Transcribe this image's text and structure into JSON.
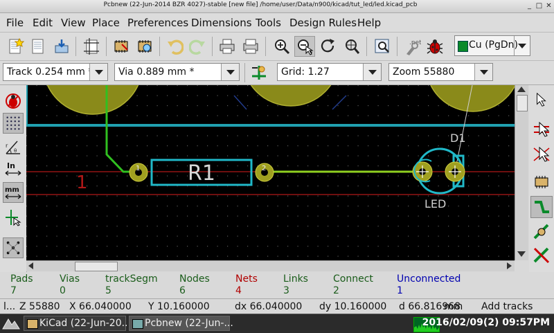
{
  "window": {
    "title": "Pcbnew (22-Jun-2014 BZR 4027)-stable  [new file] /home/user/Data/n900/kicad/tut_led/led.kicad_pcb",
    "min": "_",
    "max": "□",
    "close": "✕"
  },
  "menu": [
    "File",
    "Edit",
    "View",
    "Place",
    "Preferences",
    "Dimensions",
    "Tools",
    "Design Rules",
    "Help"
  ],
  "toolbar": {
    "layer_label": "Cu (PgDn)",
    "icons": [
      "new-board-icon",
      "open-board-icon",
      "save-icon",
      "page-settings-icon",
      "module-editor-icon",
      "module-viewer-icon",
      "undo-icon",
      "redo-icon",
      "print-icon",
      "plot-icon",
      "zoom-in-icon",
      "zoom-out-icon",
      "redraw-icon",
      "zoom-fit-icon",
      "find-icon",
      "netlist-icon",
      "drc-icon"
    ]
  },
  "aux_toolbar": {
    "track": "Track 0.254 mm *",
    "via": "Via 0.889 mm *",
    "grid": "Grid: 1.27",
    "zoom": "Zoom 55880"
  },
  "canvas": {
    "net_label": "1",
    "resistor_ref": "R1",
    "led_ref": "D1",
    "led_value": "LED",
    "pad1": "1",
    "pad2": "2"
  },
  "msg_panel": [
    {
      "label": "Pads",
      "value": "7",
      "color": "#1a5c1a"
    },
    {
      "label": "Vias",
      "value": "0",
      "color": "#1a5c1a"
    },
    {
      "label": "trackSegm",
      "value": "5",
      "color": "#1a5c1a"
    },
    {
      "label": "Nodes",
      "value": "6",
      "color": "#1a5c1a"
    },
    {
      "label": "Nets",
      "value": "4",
      "color": "#b00000"
    },
    {
      "label": "Links",
      "value": "3",
      "color": "#1a5c1a"
    },
    {
      "label": "Connect",
      "value": "2",
      "color": "#1a5c1a"
    },
    {
      "label": "Unconnected",
      "value": "1",
      "color": "#0000b0"
    }
  ],
  "status": {
    "first": "l...",
    "zoom": "Z 55880",
    "x": "X 66.040000",
    "y": "Y 10.160000",
    "dx": "dx 66.040000",
    "dy": "dy 10.160000",
    "d": "d 66.816968",
    "units": "mm",
    "mode": "Add tracks"
  },
  "taskbar": {
    "task1": "KiCad (22-Jun-20...",
    "task2": "Pcbnew (22-Jun-...",
    "clock": "2016/02/09(2) 09:57PM"
  }
}
